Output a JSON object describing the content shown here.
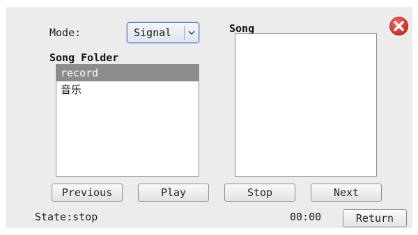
{
  "mode": {
    "label": "Mode:",
    "selected": "Signal"
  },
  "song_folder": {
    "title": "Song Folder",
    "items": [
      {
        "label": "record",
        "selected": true
      },
      {
        "label": "音乐",
        "selected": false
      }
    ]
  },
  "song": {
    "title": "Song",
    "items": []
  },
  "buttons": {
    "previous": "Previous",
    "play": "Play",
    "stop": "Stop",
    "next": "Next",
    "return": "Return"
  },
  "status": {
    "state_text": "State:stop",
    "time": "00:00"
  },
  "colors": {
    "close_red": "#d9342b",
    "selection": "#8c8c8c",
    "focus_blue": "#4e7cc0"
  },
  "icons": {
    "close": "close-circle-icon",
    "dropdown": "chevron-down-icon"
  }
}
